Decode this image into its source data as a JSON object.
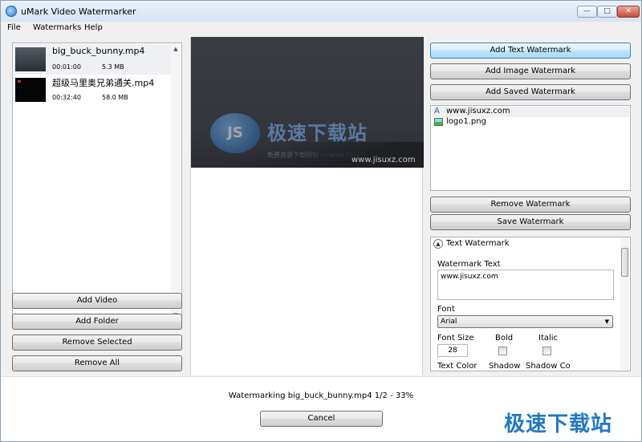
{
  "app": {
    "title": "uMark Video Watermarker",
    "window_controls": {
      "minimize": "—",
      "maximize": "□",
      "close": "✕"
    }
  },
  "menu": [
    "File",
    "Watermarks",
    "Help"
  ],
  "videos": [
    {
      "name": "big_buck_bunny.mp4",
      "duration": "00:01:00",
      "size": "5.3 MB",
      "selected": true
    },
    {
      "name": "超级马里奥兄弟通关.mp4",
      "duration": "00:32:40",
      "size": "58.0 MB",
      "selected": false
    }
  ],
  "left_buttons": {
    "add_video": "Add Video",
    "add_folder": "Add Folder",
    "remove_selected": "Remove Selected",
    "remove_all": "Remove All"
  },
  "preview": {
    "overlay_logo_text": "JS",
    "overlay_title": "极速下载站",
    "overlay_subtitle": "免费资源下载网站 — www.jisuxz.com",
    "overlay_url": "www.jisuxz.com"
  },
  "right_buttons": {
    "add_text": "Add Text Watermark",
    "add_image": "Add Image Watermark",
    "add_saved": "Add Saved Watermark",
    "remove": "Remove Watermark",
    "save": "Save Watermark"
  },
  "watermarks": [
    {
      "type_icon": "text-icon",
      "label": "www.jisuxz.com",
      "selected": true
    },
    {
      "type_icon": "image-icon",
      "label": "logo1.png",
      "selected": false
    }
  ],
  "properties": {
    "section_title": "Text Watermark",
    "watermark_text_label": "Watermark Text",
    "watermark_text_value": "www.jisuxz.com",
    "font_label": "Font",
    "font_value": "Arial",
    "font_size_label": "Font Size",
    "font_size_value": "28",
    "bold_label": "Bold",
    "italic_label": "Italic",
    "text_color_label": "Text Color",
    "shadow_label": "Shadow",
    "shadow_color_label": "Shadow Colo"
  },
  "status": {
    "text": "Watermarking big_buck_bunny.mp4  1/2 - 33%",
    "cancel_label": "Cancel"
  },
  "branding": {
    "footer_logo": "极速下载站"
  }
}
